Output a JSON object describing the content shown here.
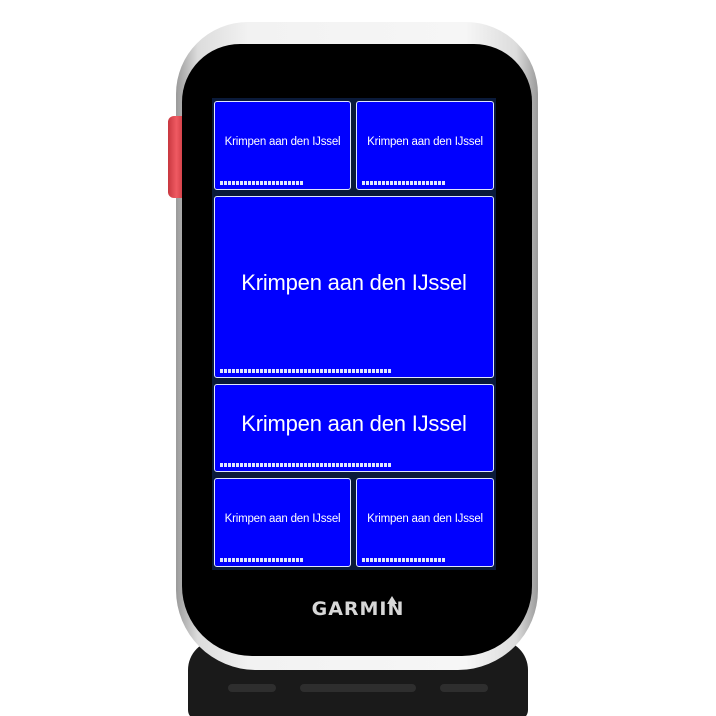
{
  "device": {
    "brand": "GARMIN"
  },
  "fields": {
    "top_left": {
      "label": "Krimpen aan den IJssel"
    },
    "top_right": {
      "label": "Krimpen aan den IJssel"
    },
    "main": {
      "label": "Krimpen aan den IJssel"
    },
    "middle": {
      "label": "Krimpen aan den IJssel"
    },
    "bottom_left": {
      "label": "Krimpen aan den IJssel"
    },
    "bottom_right": {
      "label": "Krimpen aan den IJssel"
    }
  },
  "colors": {
    "field_background": "#0000ff",
    "field_border": "#dfe6ff",
    "field_text": "#ffffff",
    "bezel": "#000000",
    "side_button": "#ef5a62"
  },
  "icons": [
    "garmin-triangle-icon"
  ]
}
